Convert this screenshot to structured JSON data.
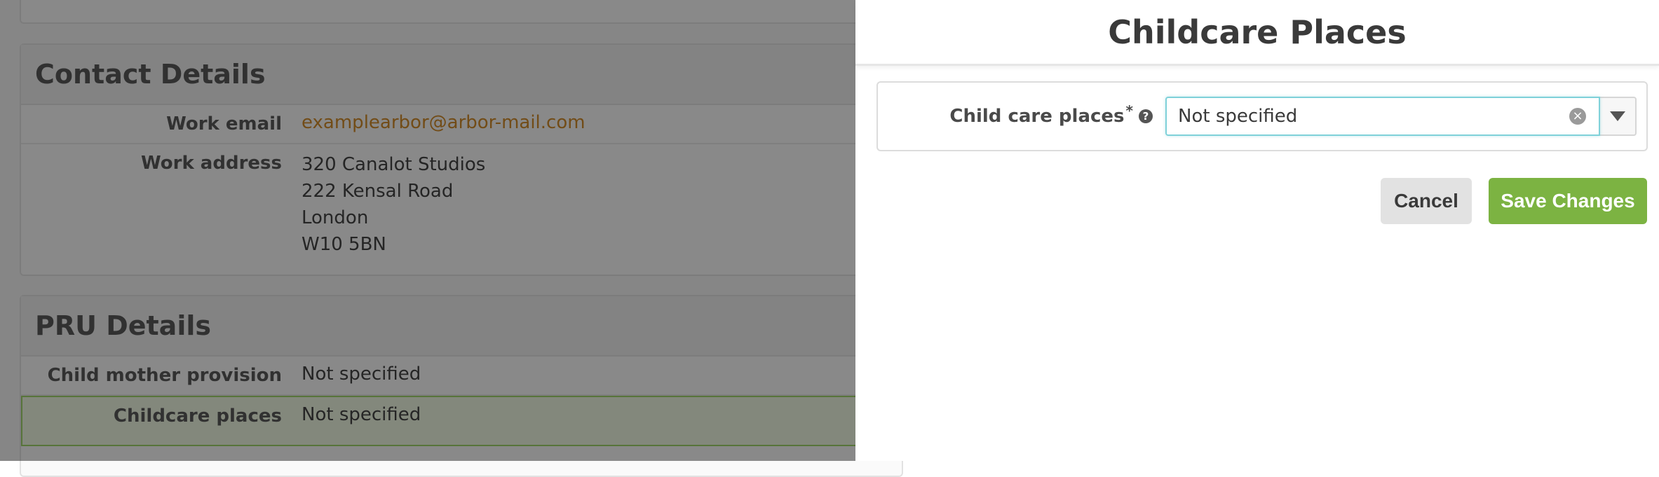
{
  "background": {
    "contact": {
      "title": "Contact Details",
      "work_email_label": "Work email",
      "work_email_value": "examplearbor@arbor-mail.com",
      "work_address_label": "Work address",
      "work_address_lines": [
        "320 Canalot Studios",
        "222 Kensal Road",
        "London",
        "W10 5BN"
      ]
    },
    "pru": {
      "title": "PRU Details",
      "child_mother_label": "Child mother provision",
      "child_mother_value": "Not specified",
      "childcare_label": "Childcare places",
      "childcare_value": "Not specified"
    }
  },
  "dialog": {
    "title": "Childcare Places",
    "field_label": "Child care places",
    "required_marker": "*",
    "help_icon": "question-circle-icon",
    "select_value": "Not specified",
    "clear_icon": "clear-circle-icon",
    "dropdown_icon": "chevron-down-icon",
    "cancel_label": "Cancel",
    "save_label": "Save Changes"
  },
  "colors": {
    "accent_green": "#7cb342",
    "link_orange": "#d08a2a",
    "focus_teal": "#7fd1d9"
  }
}
